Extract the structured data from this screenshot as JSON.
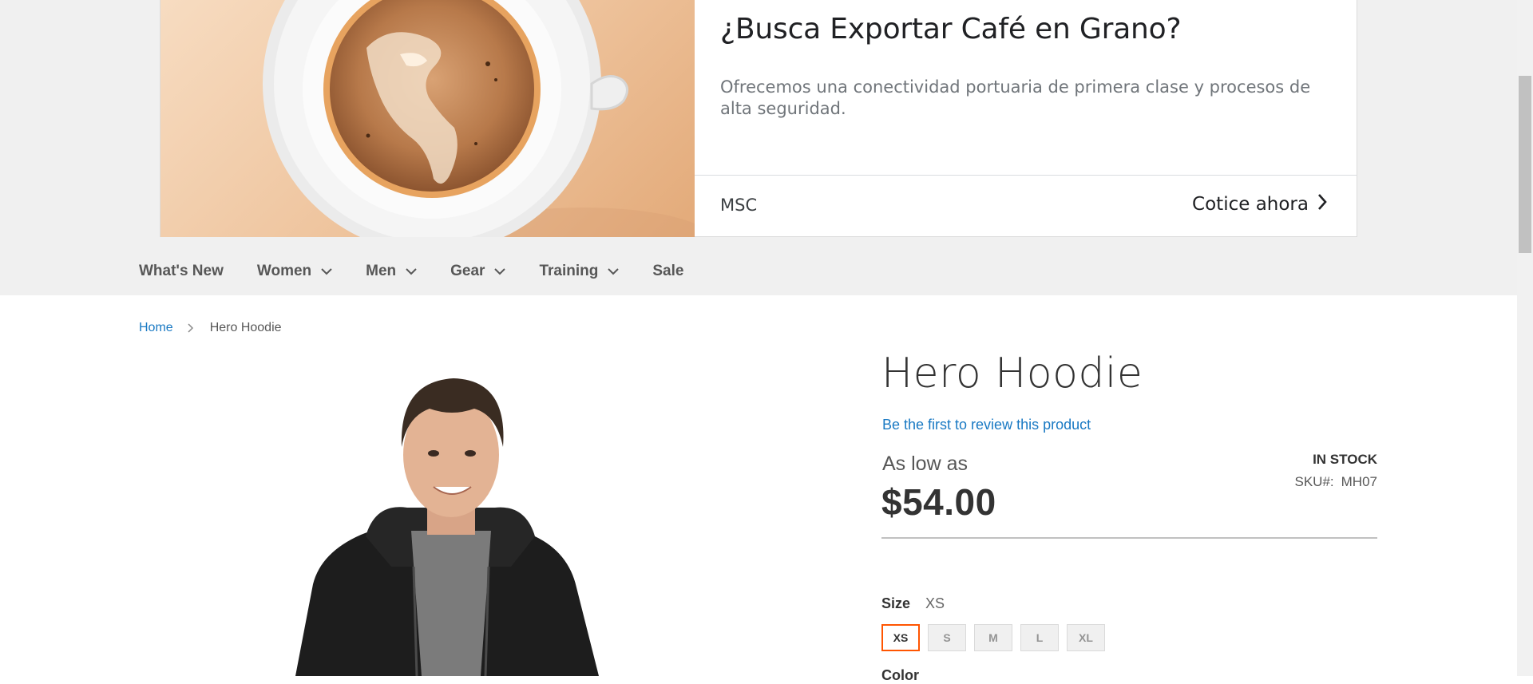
{
  "ad": {
    "headline": "¿Busca Exportar Café en Grano?",
    "body": "Ofrecemos una conectividad portuaria de primera clase y procesos de alta seguridad.",
    "advertiser": "MSC",
    "cta": "Cotice ahora",
    "cta_icon": "chevron-right-icon"
  },
  "nav": {
    "items": [
      {
        "label": "What's New",
        "has_dropdown": false
      },
      {
        "label": "Women",
        "has_dropdown": true
      },
      {
        "label": "Men",
        "has_dropdown": true
      },
      {
        "label": "Gear",
        "has_dropdown": true
      },
      {
        "label": "Training",
        "has_dropdown": true
      },
      {
        "label": "Sale",
        "has_dropdown": false
      }
    ]
  },
  "breadcrumb": {
    "home": "Home",
    "current": "Hero Hoodie"
  },
  "product": {
    "title": "Hero Hoodie",
    "review_link": "Be the first to review this product",
    "price_prefix": "As low as",
    "price": "$54.00",
    "stock": "IN STOCK",
    "sku_label": "SKU#:",
    "sku": "MH07",
    "size_label": "Size",
    "size_selected": "XS",
    "sizes": [
      "XS",
      "S",
      "M",
      "L",
      "XL"
    ],
    "color_label": "Color"
  },
  "colors": {
    "link": "#1979c3",
    "selected_swatch_border": "#ff5501",
    "nav_band": "#f0f0f0"
  }
}
